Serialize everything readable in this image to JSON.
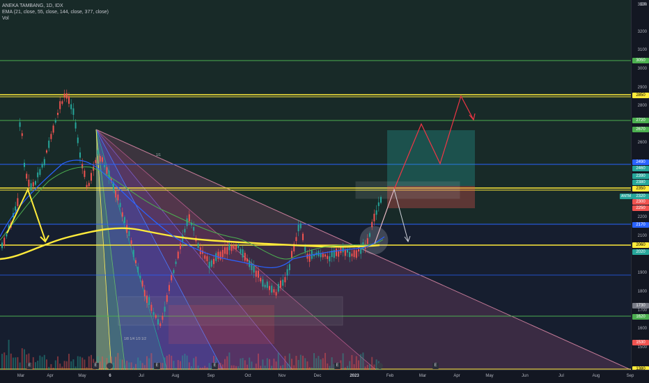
{
  "legend": {
    "title": "ANEKA TAMBANG, 1D, IDX",
    "ema": "EMA (21, close, 55, close, 144, close, 377, close)",
    "vol": "Vol"
  },
  "price_scale": {
    "currency": "IDR",
    "ticks": [
      "3300",
      "3200",
      "3100",
      "3000",
      "2900",
      "2800",
      "2600",
      "2200",
      "2100",
      "2000",
      "1900",
      "1800",
      "1700",
      "1600",
      "1500"
    ],
    "tags": [
      {
        "value": "3050",
        "bg": "#4caf50",
        "fg": "#ffffff"
      },
      {
        "value": "2850",
        "bg": "#ffeb3b",
        "fg": "#000000"
      },
      {
        "value": "2720",
        "bg": "#4caf50",
        "fg": "#ffffff"
      },
      {
        "value": "2670",
        "bg": "#4caf50",
        "fg": "#ffffff"
      },
      {
        "value": "2490",
        "bg": "#2962ff",
        "fg": "#ffffff"
      },
      {
        "value": "2460",
        "bg": "#26a69a",
        "fg": "#ffffff"
      },
      {
        "value": "2390",
        "bg": "#26a69a",
        "fg": "#ffffff"
      },
      {
        "value": "2380",
        "bg": "#26a69a",
        "fg": "#ffffff"
      },
      {
        "value": "2350",
        "bg": "#ffeb3b",
        "fg": "#000000"
      },
      {
        "value": "2320",
        "bg": "#26a69a",
        "fg": "#ffffff"
      },
      {
        "value": "2300",
        "bg": "#ef5350",
        "fg": "#ffffff"
      },
      {
        "value": "2250",
        "bg": "#ef5350",
        "fg": "#ffffff"
      },
      {
        "value": "2170",
        "bg": "#2962ff",
        "fg": "#ffffff"
      },
      {
        "value": "2060",
        "bg": "#ffeb3b",
        "fg": "#000000"
      },
      {
        "value": "2020",
        "bg": "#26a69a",
        "fg": "#ffffff"
      },
      {
        "value": "1730",
        "bg": "#787b86",
        "fg": "#ffffff"
      },
      {
        "value": "1620",
        "bg": "#4caf50",
        "fg": "#ffffff"
      },
      {
        "value": "1530",
        "bg": "#ef5350",
        "fg": "#ffffff"
      },
      {
        "value": "1380",
        "bg": "#ffeb3b",
        "fg": "#000000"
      }
    ],
    "symbol_tag": "ANTM"
  },
  "time_scale": {
    "ticks": [
      "Mar",
      "Apr",
      "May",
      "6",
      "Jul",
      "Aug",
      "Sep",
      "Oct",
      "Nov",
      "Dec",
      "2023",
      "Feb",
      "Mar",
      "Apr",
      "May",
      "Jun",
      "Jul",
      "Aug",
      "Sep"
    ]
  },
  "fib_labels": [
    "1/1",
    "1/8 1/4 1/3 1/2"
  ],
  "events": [
    "E",
    "E",
    "E",
    "E",
    "E",
    "E",
    "E"
  ],
  "colors": {
    "background": "#131722",
    "green_zone": "#1b3a2c",
    "ema_yellow": "#ffeb3b",
    "ema_blue": "#2962ff",
    "ema_green": "#4caf50",
    "up_candle": "#26a69a",
    "down_candle": "#ef5350",
    "forecast_up": "#f23645",
    "forecast_white": "#d1d4dc"
  }
}
